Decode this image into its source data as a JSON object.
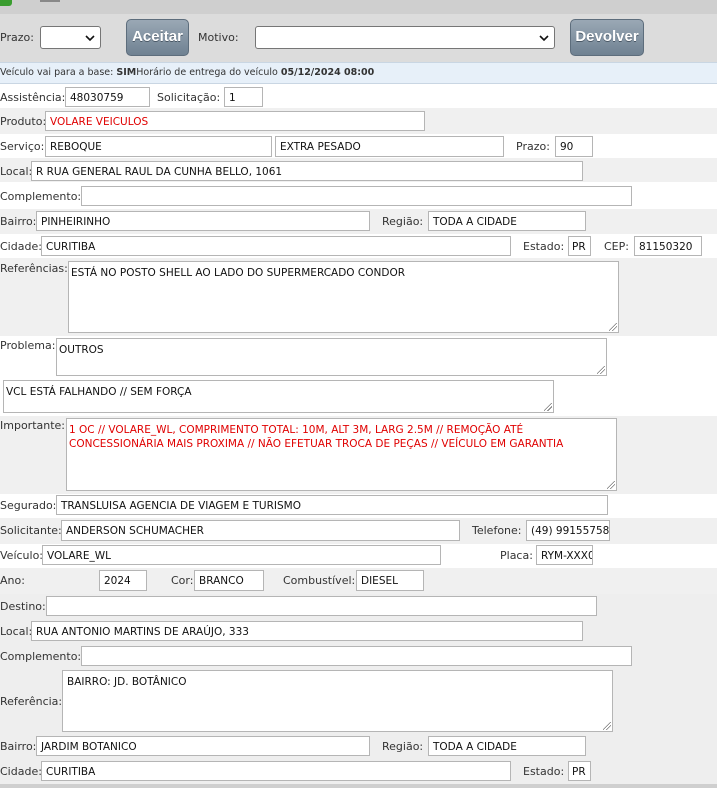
{
  "toolbar": {
    "prazo_label": "Prazo:",
    "aceitar_label": "Aceitar",
    "motivo_label": "Motivo:",
    "devolver_label": "Devolver"
  },
  "info": {
    "base_text": "Veículo vai para a base:",
    "base_value": "SIM",
    "horario_text": "Horário de entrega do veículo",
    "horario_value": "05/12/2024 08:00"
  },
  "form": {
    "assistencia_label": "Assistência:",
    "assistencia": "48030759",
    "solicitacao_label": "Solicitação:",
    "solicitacao": "1",
    "produto_label": "Produto:",
    "produto": "VOLARE VEICULOS",
    "servico_label": "Serviço:",
    "servico": "REBOQUE",
    "servico_tipo": "EXTRA PESADO",
    "prazo_label": "Prazo:",
    "prazo": "90",
    "local_label": "Local:",
    "local": "R RUA GENERAL RAUL DA CUNHA BELLO, 1061",
    "complemento_label": "Complemento:",
    "complemento": "",
    "bairro_label": "Bairro:",
    "bairro": "PINHEIRINHO",
    "regiao_label": "Região:",
    "regiao": "TODA A CIDADE",
    "cidade_label": "Cidade:",
    "cidade": "CURITIBA",
    "estado_label": "Estado:",
    "estado": "PR",
    "cep_label": "CEP:",
    "cep": "81150320",
    "referencias_label": "Referências:",
    "referencias": "ESTÁ NO POSTO SHELL  AO LADO DO SUPERMERCADO CONDOR",
    "problema_label": "Problema:",
    "problema": "OUTROS",
    "problema_desc": "VCL ESTÁ FALHANDO // SEM FORÇA",
    "importante_label": "Importante:",
    "importante": "1 OC // VOLARE_WL, COMPRIMENTO TOTAL: 10M, ALT 3M, LARG 2.5M // REMOÇÃO ATÉ CONCESSIONÁRIA MAIS PROXIMA // NÃO EFETUAR TROCA DE PEÇAS // VEÍCULO EM GARANTIA",
    "segurado_label": "Segurado:",
    "segurado": "TRANSLUISA AGENCIA DE VIAGEM E TURISMO",
    "solicitante_label": "Solicitante:",
    "solicitante": "ANDERSON SCHUMACHER",
    "telefone_label": "Telefone:",
    "telefone": "(49) 99155758",
    "veiculo_label": "Veículo:",
    "veiculo": "VOLARE_WL",
    "placa_label": "Placa:",
    "placa": "RYM-XXX0",
    "ano_label": "Ano:",
    "ano": "2024",
    "cor_label": "Cor:",
    "cor": "BRANCO",
    "combustivel_label": "Combustível:",
    "combustivel": "DIESEL"
  },
  "destino": {
    "destino_label": "Destino:",
    "destino": "",
    "local_label": "Local:",
    "local": "RUA ANTONIO MARTINS DE ARAÚJO, 333",
    "complemento_label": "Complemento:",
    "complemento": "",
    "referencia_label": "Referência:",
    "referencia": "BAIRRO: JD. BOTÂNICO",
    "bairro_label": "Bairro:",
    "bairro": "JARDIM BOTANICO",
    "regiao_label": "Região:",
    "regiao": "TODA A CIDADE",
    "cidade_label": "Cidade:",
    "cidade": "CURITIBA",
    "estado_label": "Estado:",
    "estado": "PR"
  },
  "colors": {
    "toolbar_bg": "#dcdcdc",
    "info_bg": "#e7f0f9",
    "section_bg": "#f0f0f0",
    "button": "#7d8e9e",
    "important_text": "#e00000"
  }
}
